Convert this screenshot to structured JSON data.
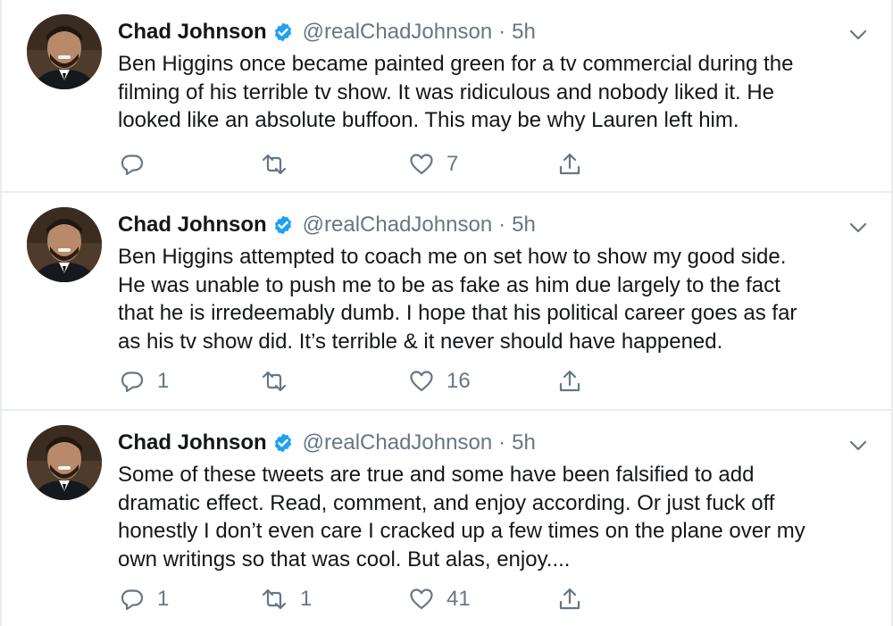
{
  "colors": {
    "primary_text": "#14171a",
    "secondary_text": "#657786",
    "verified_blue": "#1da1f2",
    "divider": "#e6ecf0"
  },
  "icons": {
    "reply": "reply-icon",
    "retweet": "retweet-icon",
    "like": "heart-icon",
    "share": "share-icon",
    "more": "chevron-down-icon",
    "verified": "verified-badge-icon"
  },
  "tweets": [
    {
      "name": "Chad Johnson",
      "handle": "@realChadJohnson",
      "separator": "·",
      "time": "5h",
      "lines": [
        "Ben Higgins once became painted green for a tv commercial during the",
        "filming of his terrible tv show. It was ridiculous and nobody liked it. He",
        "looked like an absolute buffoon. This may be why Lauren left him."
      ],
      "replies": "",
      "retweets": "",
      "likes": "7"
    },
    {
      "name": "Chad Johnson",
      "handle": "@realChadJohnson",
      "separator": "·",
      "time": "5h",
      "lines": [
        "Ben Higgins attempted to coach me on set how to show my good side.",
        "He was unable to push me to be as fake as him due largely to the fact",
        "that he is irredeemably dumb. I hope that his political career goes as far",
        "as his tv show did. It’s terrible & it never should have happened."
      ],
      "replies": "1",
      "retweets": "",
      "likes": "16"
    },
    {
      "name": "Chad Johnson",
      "handle": "@realChadJohnson",
      "separator": "·",
      "time": "5h",
      "lines": [
        "Some of these tweets are true and some have been falsified to add",
        "dramatic effect. Read, comment, and enjoy according. Or just fuck off",
        "honestly I don’t even care I cracked up a few times on the plane over my",
        "own writings so that was cool. But alas, enjoy...."
      ],
      "replies": "1",
      "retweets": "1",
      "likes": "41"
    }
  ]
}
